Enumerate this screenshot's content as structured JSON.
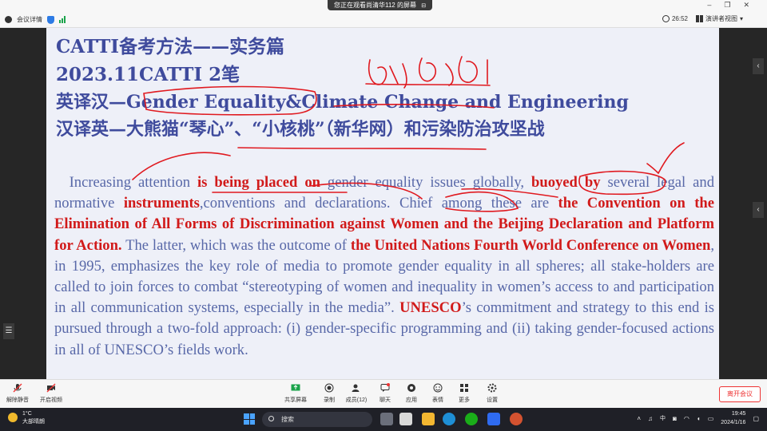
{
  "top_bar": {
    "share_indicator": "您正在观看尚清华112 的屏幕",
    "meeting_info": "会议详情",
    "timer": "26:52",
    "view_label": "演讲者视图"
  },
  "slide": {
    "title_line1": "CATTI备考方法——实务篇",
    "title_line2": "2023.11CATTI  2笔",
    "line3_prefix": "英译汉—",
    "line3_topic1": "Gender Equality",
    "line3_amp": "&",
    "line3_topic2": "Climate Change and Engineering",
    "line4": "汉译英—大熊猫“琴心”、“小核桃”（新华网）和污染防治攻坚战",
    "paragraph": {
      "s1": "Increasing attention ",
      "r1": "is being placed on",
      "s2": " gender equality issues globally, ",
      "r2": "buoyed by",
      "s3": " several legal and normative ",
      "r3": "instruments",
      "s4": ",conventions and declarations. Chief among these are ",
      "r4": "the Convention on the Elimination of All Forms of Discrimination against Women and the Beijing Declaration and Platform for Action.",
      "s5": " The latter, which was the outcome of ",
      "r5": "the United Nations Fourth World Conference on Women",
      "s6": ", in 1995, emphasizes the key role of media to promote gender equality in all spheres; all stake-holders are called to join forces to combat “stereotyping of women and inequality in women’s access to and participation in all communication systems, especially in the media”. ",
      "r6": "UNESCO",
      "s7": "’s commitment and strategy to this end is pursued through a two-fold approach: (i) gender-specific programming and (ii) taking gender-focused actions in all of UNESCO’s fields work."
    }
  },
  "toolbar": {
    "mic": "解除静音",
    "video": "开启视频",
    "share": "共享屏幕",
    "record": "录制",
    "participants": "成员(12)",
    "chat": "聊天",
    "apps": "应用",
    "reactions": "表情",
    "more": "更多",
    "settings": "设置",
    "leave": "离开会议"
  },
  "taskbar": {
    "temp": "1°C",
    "weather_desc": "大部晴朗",
    "search_placeholder": "搜索",
    "ime_cn": "中",
    "time": "19:45",
    "date": "2024/1/16"
  },
  "colors": {
    "slide_text": "#5868a8",
    "slide_title": "#3f4b9d",
    "emphasis_red": "#d11a1a",
    "ink_red": "#e0191f"
  }
}
